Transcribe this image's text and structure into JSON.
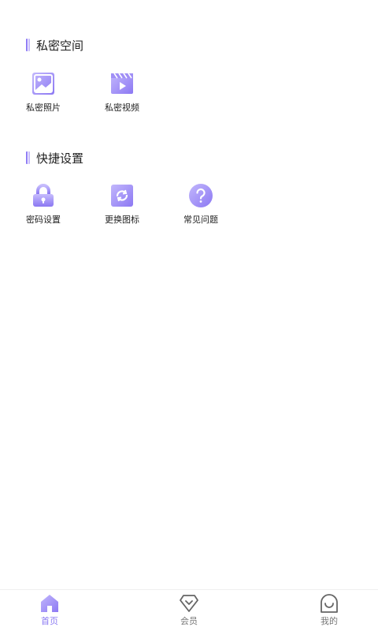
{
  "sections": [
    {
      "title": "私密空间",
      "items": [
        {
          "label": "私密照片",
          "icon": "photo-icon"
        },
        {
          "label": "私密视频",
          "icon": "video-icon"
        }
      ]
    },
    {
      "title": "快捷设置",
      "items": [
        {
          "label": "密码设置",
          "icon": "lock-icon"
        },
        {
          "label": "更换图标",
          "icon": "swap-icon"
        },
        {
          "label": "常见问题",
          "icon": "question-icon"
        }
      ]
    }
  ],
  "tabbar": {
    "items": [
      {
        "label": "首页",
        "icon": "home-icon",
        "active": true
      },
      {
        "label": "会员",
        "icon": "diamond-icon",
        "active": false
      },
      {
        "label": "我的",
        "icon": "profile-icon",
        "active": false
      }
    ]
  },
  "colors": {
    "accent": "#8b7af2",
    "accent_light": "#b6a8fb"
  }
}
